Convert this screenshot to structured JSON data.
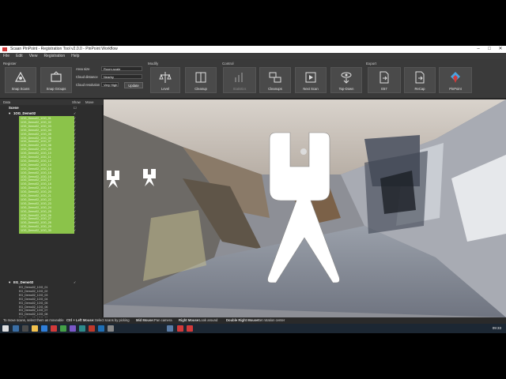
{
  "window": {
    "title": "Scaan PinPoint - Registration Tool v2.0.0 - PinPoint Workflow"
  },
  "menu": [
    "File",
    "Edit",
    "View",
    "Registration",
    "Help"
  ],
  "ribbon": {
    "groups": {
      "register": "Register",
      "modify": "Modify",
      "control": "Control",
      "export": "Export"
    },
    "buttons": {
      "snap_scans": "Snap Scans",
      "snap_groups": "Snap Groups",
      "level": "Level",
      "cleanup": "Cleanup",
      "statistics": "Statistics",
      "cleanups": "Cleanups",
      "next_scan": "Next Scan",
      "top_down": "Top-Down",
      "e57": "E57",
      "recap": "ReCap",
      "pinpoint": "PinPoint",
      "update": "Update"
    },
    "settings": {
      "area_size_label": "Area size",
      "area_size_value": "Room-scale",
      "cloud_distance_label": "Cloud distance",
      "cloud_distance_value": "Nearby",
      "cloud_resolution_label": "Cloud resolution",
      "cloud_resolution_value": "Very High"
    }
  },
  "panel": {
    "headers": {
      "data": "Data",
      "show": "Show",
      "move": "Move"
    },
    "scene": "Scene",
    "group1": "1OG_Demo02",
    "group1_scans": [
      "1OG_Demo02_1OG_01",
      "1OG_Demo02_1OG_02",
      "1OG_Demo02_1OG_03",
      "1OG_Demo02_1OG_04",
      "1OG_Demo02_1OG_05",
      "1OG_Demo02_1OG_06",
      "1OG_Demo02_1OG_07",
      "1OG_Demo02_1OG_08",
      "1OG_Demo02_1OG_09",
      "1OG_Demo02_1OG_10",
      "1OG_Demo02_1OG_11",
      "1OG_Demo02_1OG_12",
      "1OG_Demo02_1OG_13",
      "1OG_Demo02_1OG_14",
      "1OG_Demo02_1OG_15",
      "1OG_Demo02_1OG_16",
      "1OG_Demo02_1OG_17",
      "1OG_Demo02_1OG_18",
      "1OG_Demo02_1OG_19",
      "1OG_Demo02_1OG_20",
      "1OG_Demo02_1OG_21",
      "1OG_Demo02_1OG_22",
      "1OG_Demo02_1OG_23",
      "1OG_Demo02_1OG_24",
      "1OG_Demo02_1OG_25",
      "1OG_Demo02_1OG_26",
      "1OG_Demo02_1OG_27",
      "1OG_Demo02_1OG_28",
      "1OG_Demo02_1OG_29",
      "1OG_Demo02_1OG_30"
    ],
    "group2": "EG_Demo02",
    "group2_scans": [
      "EG_Demo02_1OG_01",
      "EG_Demo02_1OG_02",
      "EG_Demo02_1OG_03",
      "EG_Demo02_1OG_04",
      "EG_Demo02_1OG_05",
      "EG_Demo02_1OG_06",
      "EG_Demo02_1OG_07",
      "EG_Demo02_1OG_08",
      "EG_Demo02_1OG_09",
      "EG_Demo02_1OG_10",
      "EG_Demo02_1OG_11",
      "EG_Demo02_1OG_12",
      "EG_Demo02_1OG_13",
      "EG_Demo02_1OG_14",
      "EG_Demo02_1OG_15",
      "EG_Demo02_1OG_16",
      "EG_Demo02_1OG_17"
    ]
  },
  "status": {
    "hint": "To move scans, select them as moveable",
    "ctrl_left": "Ctrl + Left Mouse:",
    "ctrl_left_action": "Select scans by picking",
    "mid_mouse": "Mid Mouse:",
    "mid_mouse_action": "Pan camera",
    "right_mouse": "Right Mouse:",
    "right_mouse_action": "Look around",
    "double_right": "Double Right Mouse:",
    "double_right_action": "Set rotation center"
  },
  "taskbar": {
    "clock": "09:33"
  },
  "colors": {
    "selection_green": "#8bc34a",
    "ribbon_bg": "#3a3a3a",
    "panel_bg": "#2d2d2d",
    "accent_red": "#d23a3a"
  }
}
